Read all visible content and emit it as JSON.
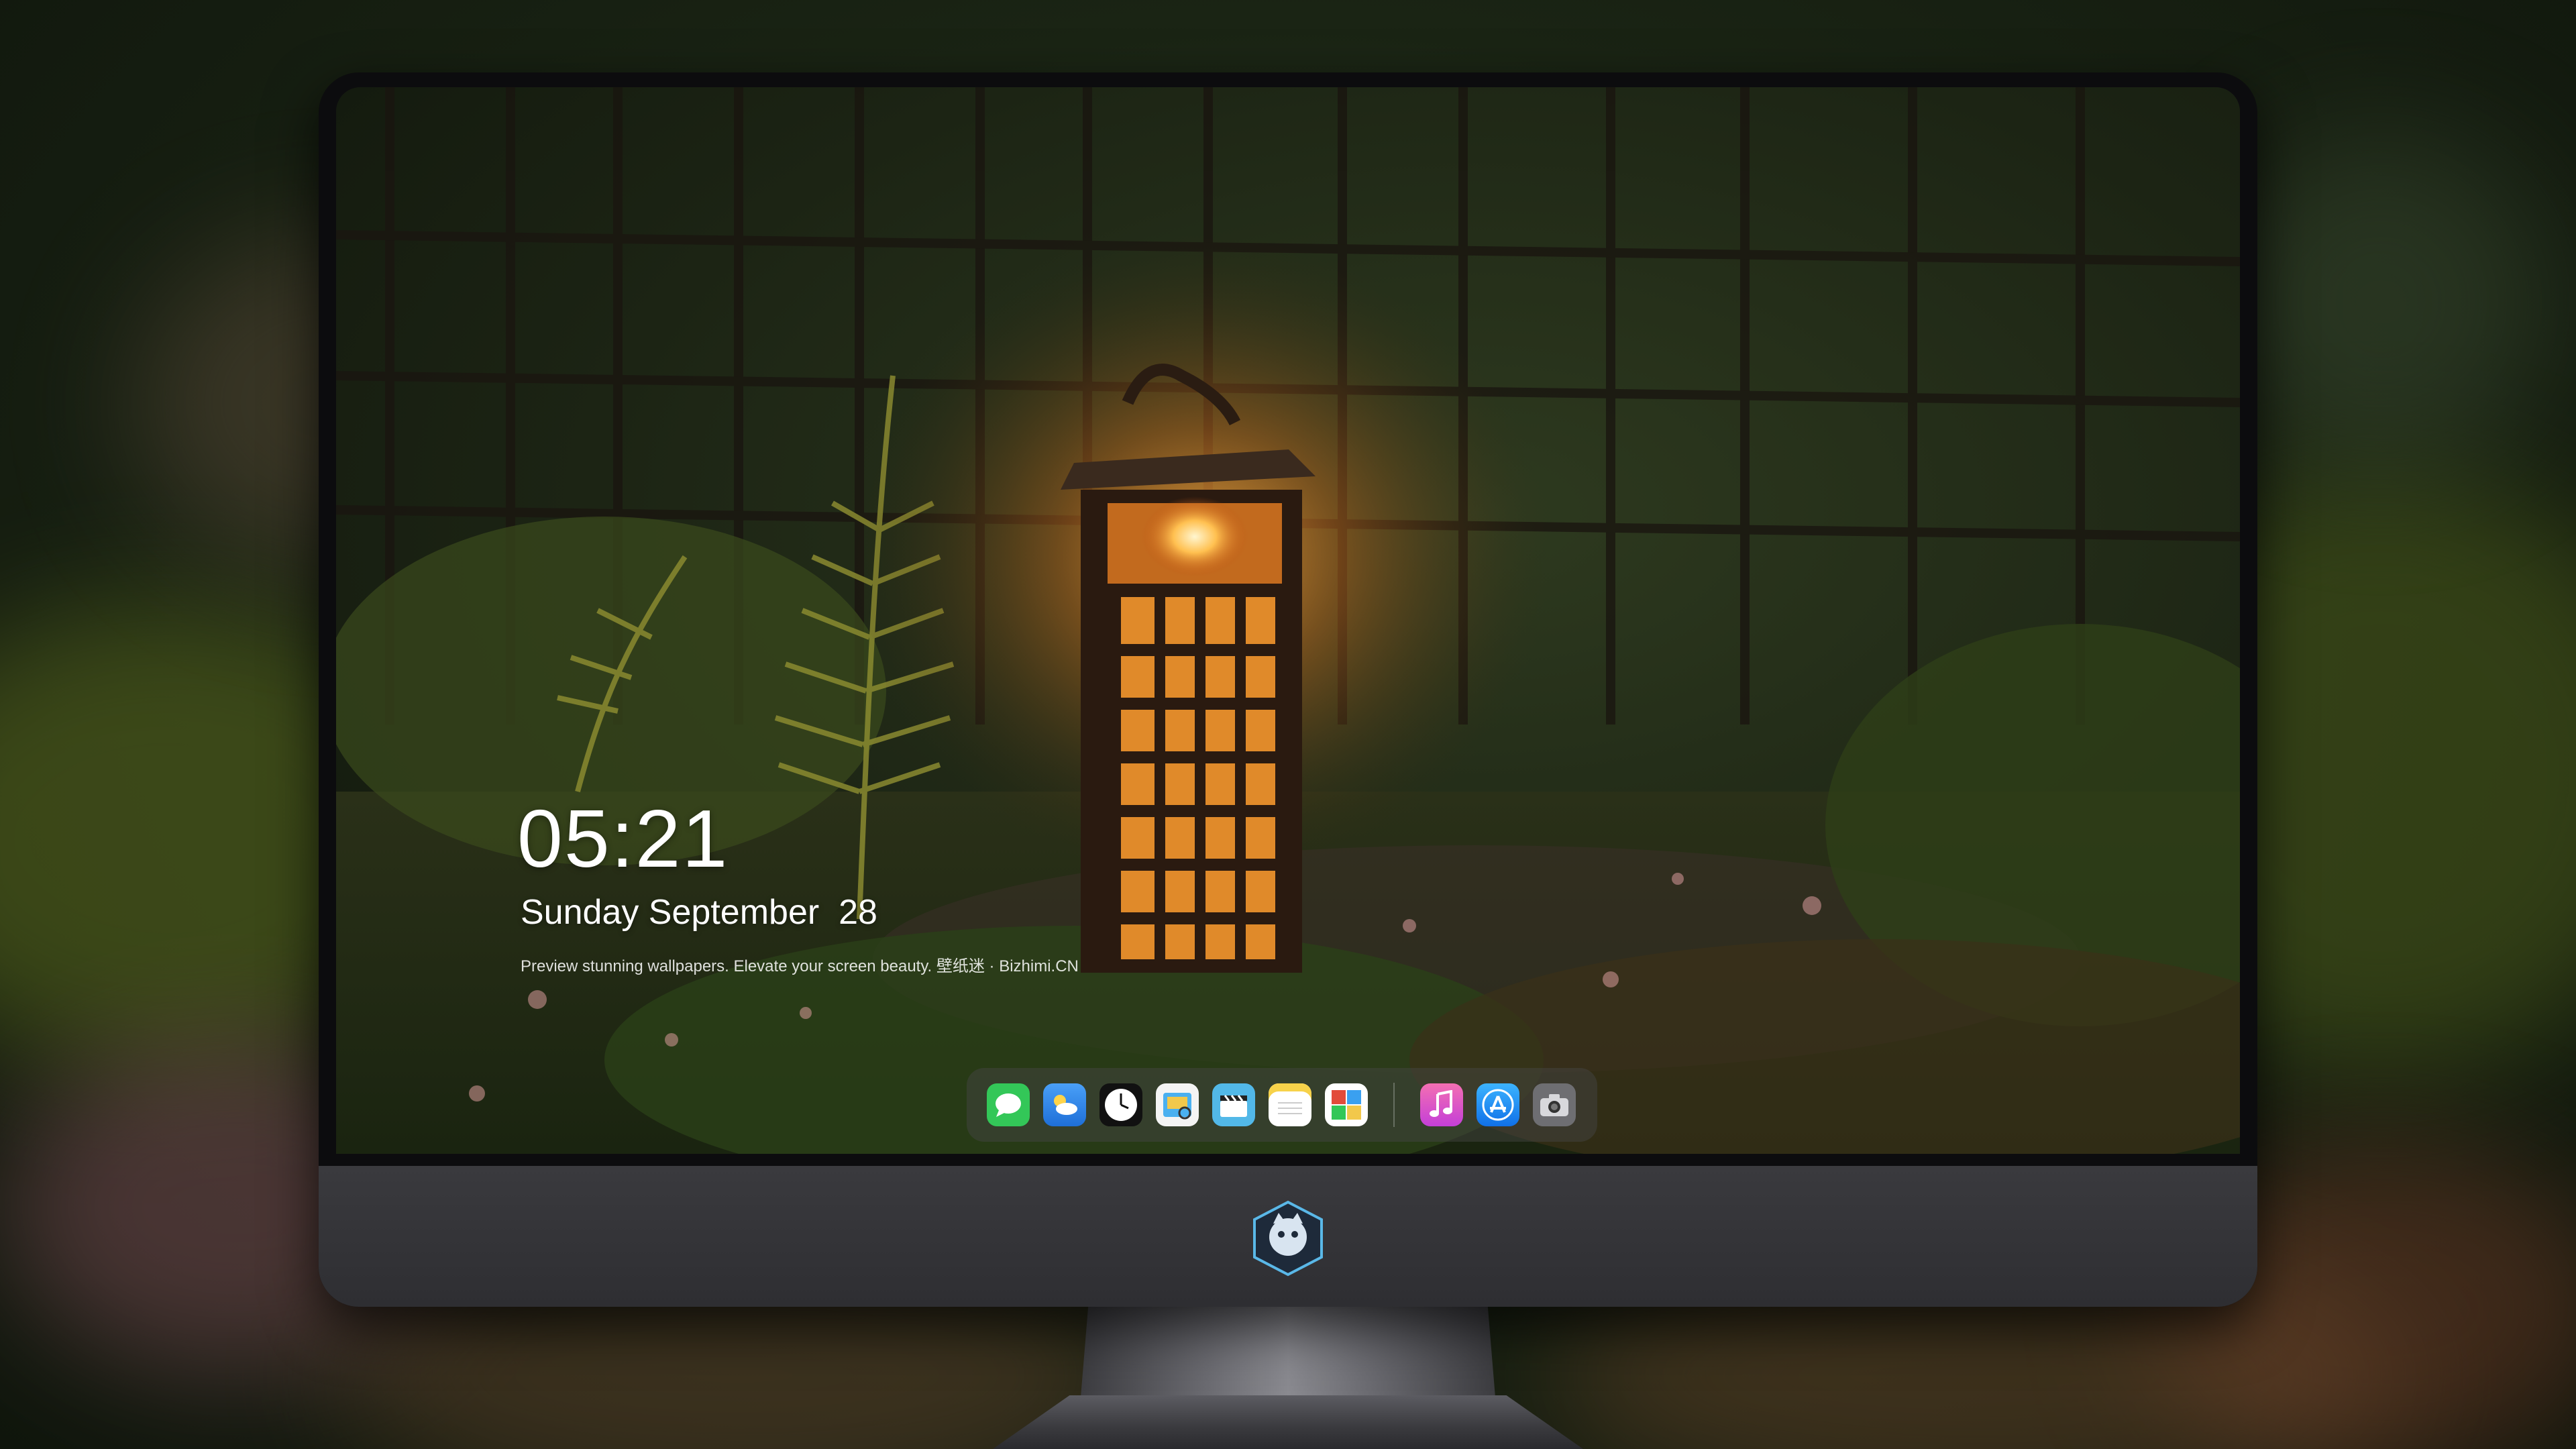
{
  "lock_screen": {
    "time": "05:21",
    "date": "Sunday September  28",
    "tagline": "Preview stunning wallpapers. Elevate your screen beauty. 壁纸迷 · Bizhimi.CN"
  },
  "dock": {
    "apps": [
      {
        "name": "Messages",
        "icon": "messages-icon",
        "color": "#33c758"
      },
      {
        "name": "Weather",
        "icon": "weather-icon",
        "color": "#3a8ef0"
      },
      {
        "name": "Clock",
        "icon": "clock-icon",
        "color": "#111111"
      },
      {
        "name": "Preview",
        "icon": "preview-icon",
        "color": "#f2c84b"
      },
      {
        "name": "Clips",
        "icon": "clapperboard-icon",
        "color": "#52b8e8"
      },
      {
        "name": "Notes",
        "icon": "notes-icon",
        "color": "#f7d24a"
      },
      {
        "name": "Photo Booth",
        "icon": "photos-icon",
        "color": "#e24b3b"
      },
      {
        "name": "Music",
        "icon": "music-icon",
        "color": "#ee4fa0"
      },
      {
        "name": "App Store",
        "icon": "app-store-icon",
        "color": "#1f8cf5"
      },
      {
        "name": "Camera",
        "icon": "camera-icon",
        "color": "#6e6e72"
      }
    ]
  }
}
